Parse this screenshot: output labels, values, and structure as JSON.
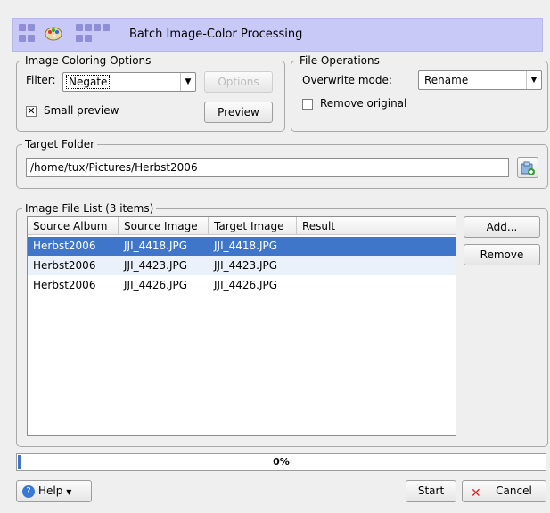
{
  "window": {
    "title": "Batch Image-Color Processing"
  },
  "coloring": {
    "legend": "Image Coloring Options",
    "filter_label": "Filter:",
    "filter_value": "Negate",
    "options_button": "Options",
    "small_preview_label": "Small preview",
    "small_preview_checked": true,
    "preview_button": "Preview"
  },
  "file_ops": {
    "legend": "File Operations",
    "overwrite_label": "Overwrite mode:",
    "overwrite_value": "Rename",
    "remove_original_label": "Remove original",
    "remove_original_checked": false
  },
  "target": {
    "legend": "Target Folder",
    "path": "/home/tux/Pictures/Herbst2006"
  },
  "file_list": {
    "legend": "Image File List (3 items)",
    "columns": [
      "Source Album",
      "Source Image",
      "Target Image",
      "Result"
    ],
    "rows": [
      [
        "Herbst2006",
        "JJI_4418.JPG",
        "JJI_4418.JPG",
        ""
      ],
      [
        "Herbst2006",
        "JJI_4423.JPG",
        "JJI_4423.JPG",
        ""
      ],
      [
        "Herbst2006",
        "JJI_4426.JPG",
        "JJI_4426.JPG",
        ""
      ]
    ],
    "add_button": "Add...",
    "remove_button": "Remove"
  },
  "progress": {
    "value": 0,
    "label": "0%"
  },
  "footer": {
    "help_button": "Help",
    "start_button": "Start",
    "cancel_button": "Cancel"
  },
  "colors": {
    "banner": "#c9c9f8",
    "selection": "#3f76c9",
    "cancel_icon": "#e0231f",
    "help_icon": "#3a78d6"
  }
}
